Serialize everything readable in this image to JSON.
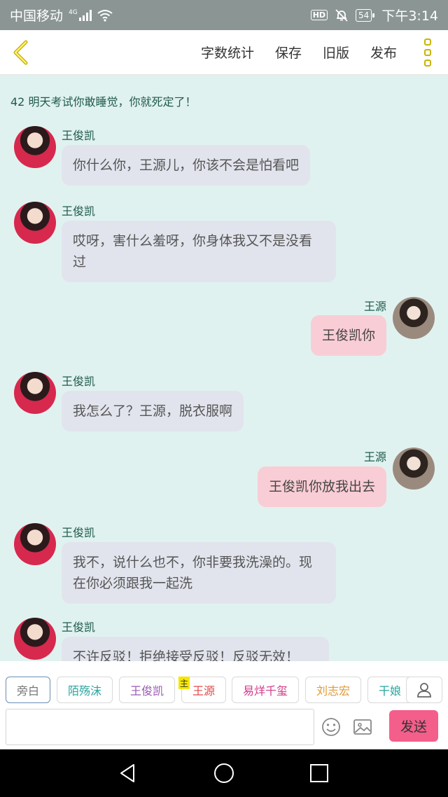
{
  "status_bar": {
    "carrier": "中国移动",
    "network": "4G",
    "hd": "HD",
    "battery": "54",
    "time": "下午3:14",
    "icons": [
      "signal-icon",
      "wifi-icon",
      "hd-icon",
      "mute-bell-icon",
      "battery-icon"
    ]
  },
  "toolbar": {
    "back_icon": "chevron-left-icon",
    "word_count": "字数统计",
    "save": "保存",
    "old_version": "旧版",
    "publish": "发布",
    "more_icon": "more-vertical-icon",
    "accent": "#c9b400"
  },
  "chapter_title": "42 明天考试你敢睡觉，你就死定了！",
  "messages": [
    {
      "side": "left",
      "sender": "王俊凯",
      "text": "你什么你，王源儿，你该不会是怕看吧"
    },
    {
      "side": "left",
      "sender": "王俊凯",
      "text": "哎呀，害什么羞呀，你身体我又不是没看过"
    },
    {
      "side": "right",
      "sender": "王源",
      "text": "王俊凯你"
    },
    {
      "side": "left",
      "sender": "王俊凯",
      "text": "我怎么了？王源，脱衣服啊"
    },
    {
      "side": "right",
      "sender": "王源",
      "text": "王俊凯你放我出去"
    },
    {
      "side": "left",
      "sender": "王俊凯",
      "text": "我不，说什么也不，你非要我洗澡的。现在你必须跟我一起洗"
    },
    {
      "side": "left",
      "sender": "王俊凯",
      "text": "不许反驳！拒绝接受反驳！反驳无效！"
    }
  ],
  "roles": [
    {
      "label": "旁白",
      "color": "#777777"
    },
    {
      "label": "陌殇沫",
      "color": "#2aa6a0"
    },
    {
      "label": "王俊凯",
      "color": "#9b59b6"
    },
    {
      "label": "王源",
      "color": "#e04848"
    },
    {
      "label": "易烊千玺",
      "color": "#d13b8a"
    },
    {
      "label": "刘志宏",
      "color": "#e09a3a"
    },
    {
      "label": "干娘",
      "color": "#2aa6a0"
    }
  ],
  "host_badge": "主",
  "input": {
    "value": "",
    "placeholder": ""
  },
  "send": "发送",
  "colors": {
    "background": "#e0f2f0",
    "left_bubble": "#e1e4ed",
    "right_bubble": "#f9cdd5",
    "send": "#f45e8b"
  }
}
